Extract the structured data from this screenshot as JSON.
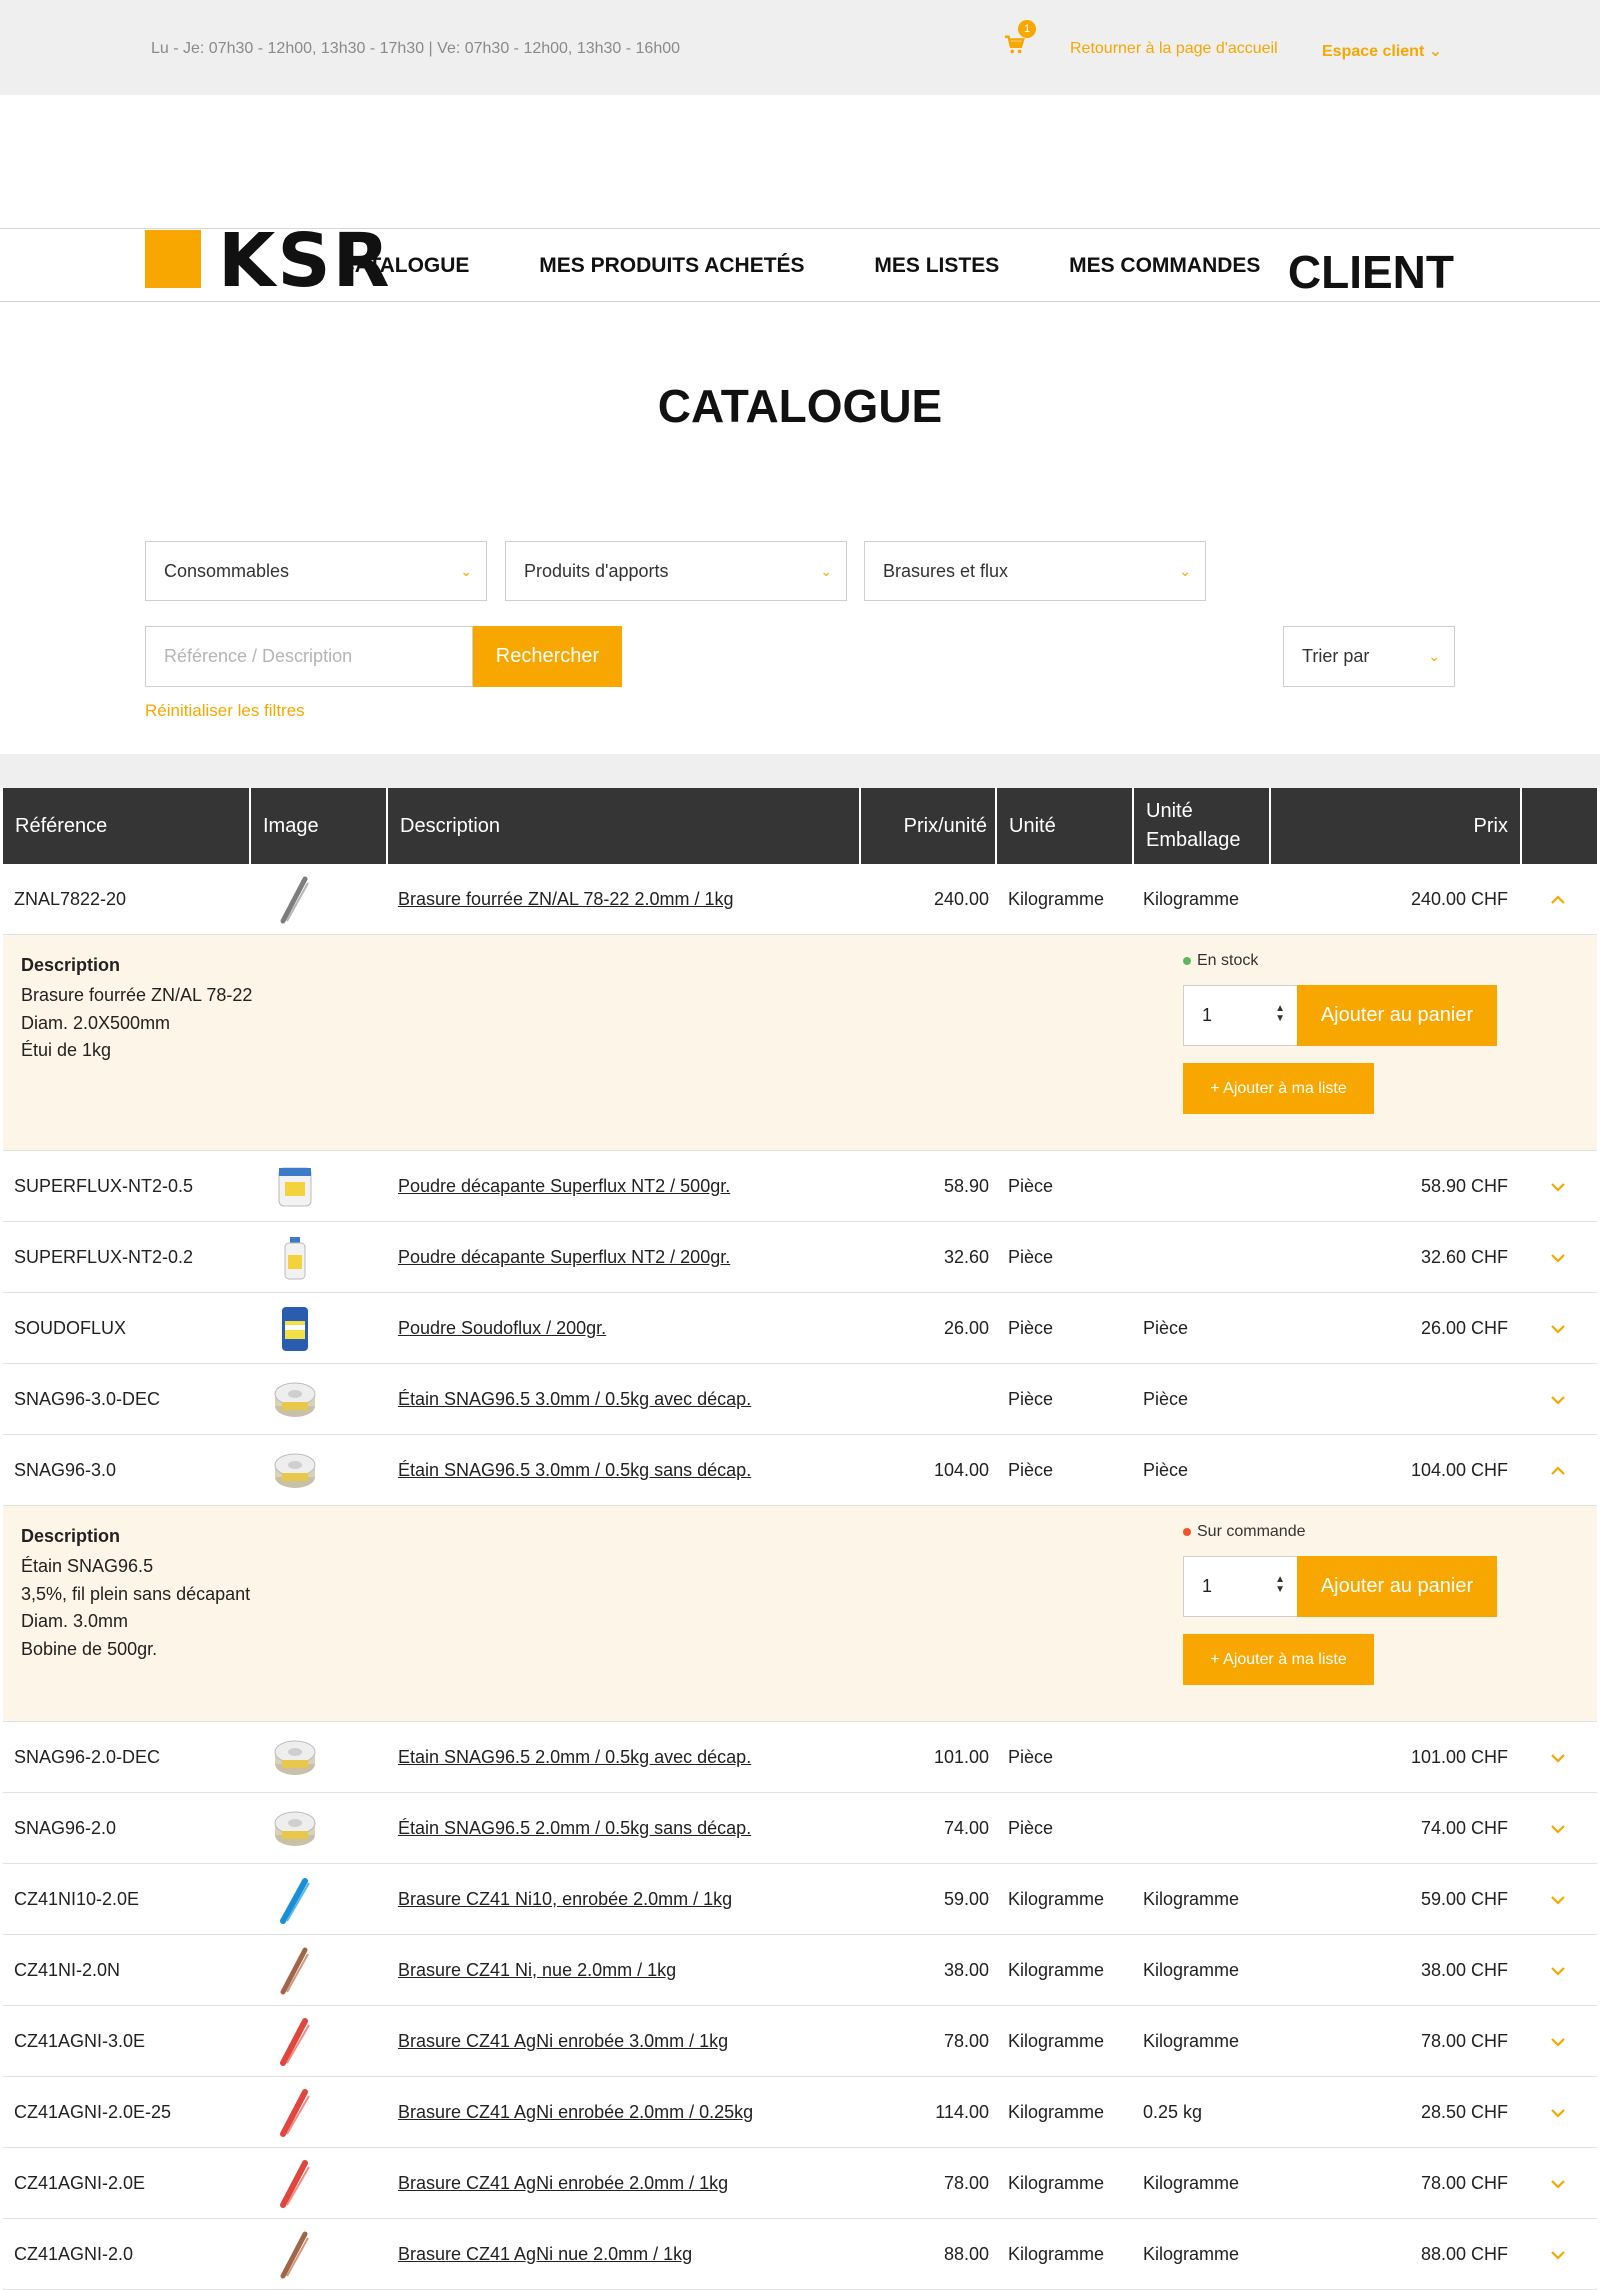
{
  "topbar": {
    "hours": "Lu - Je: 07h30 - 12h00, 13h30 - 17h30 | Ve: 07h30 - 12h00, 13h30 - 16h00",
    "cart_count": "1",
    "home_link": "Retourner à la page d'accueil",
    "espace_client": "Espace client ⌄"
  },
  "header": {
    "logo": "KSR",
    "title": "CLIENT"
  },
  "nav": [
    "CATALOGUE",
    "MES PRODUITS ACHETÉS",
    "MES LISTES",
    "MES COMMANDES"
  ],
  "page_title": "CATALOGUE",
  "filters": {
    "cat1": "Consommables",
    "cat2": "Produits d'apports",
    "cat3": "Brasures et flux",
    "search_placeholder": "Référence / Description",
    "search_button": "Rechercher",
    "sort": "Trier par",
    "reset": "Réinitialiser les filtres"
  },
  "table": {
    "headers": [
      "Référence",
      "Image",
      "Description",
      "Prix/unité",
      "Unité",
      "Unité Emballage",
      "Prix"
    ],
    "rows": [
      {
        "ref": "ZNAL7822-20",
        "img": "rod-grey",
        "desc": "Brasure fourrée ZN/AL 78-22 2.0mm / 1kg",
        "pu": "240.00",
        "unit": "Kilogramme",
        "ue": "Kilogramme",
        "prix": "240.00 CHF",
        "open": true,
        "detail": {
          "head": "Description",
          "lines": [
            "Brasure fourrée ZN/AL 78-22",
            "Diam. 2.0X500mm",
            "Étui de 1kg"
          ],
          "stock": "En stock",
          "stock_color": "#5cb85c",
          "qty": "1",
          "add_cart": "Ajouter au panier",
          "add_list": "+  Ajouter à ma liste"
        }
      },
      {
        "ref": "SUPERFLUX-NT2-0.5",
        "img": "jar-white",
        "desc": "Poudre décapante Superflux NT2 / 500gr.",
        "pu": "58.90",
        "unit": "Pièce",
        "ue": "",
        "prix": "58.90 CHF",
        "open": false
      },
      {
        "ref": "SUPERFLUX-NT2-0.2",
        "img": "bottle-white",
        "desc": "Poudre décapante Superflux NT2 / 200gr.",
        "pu": "32.60",
        "unit": "Pièce",
        "ue": "",
        "prix": "32.60 CHF",
        "open": false
      },
      {
        "ref": "SOUDOFLUX",
        "img": "jar-blue",
        "desc": "Poudre Soudoflux / 200gr.",
        "pu": "26.00",
        "unit": "Pièce",
        "ue": "Pièce",
        "prix": "26.00 CHF",
        "open": false
      },
      {
        "ref": "SNAG96-3.0-DEC",
        "img": "spool",
        "desc": "Étain SNAG96.5 3.0mm / 0.5kg avec décap.",
        "pu": "",
        "unit": "Pièce",
        "ue": "Pièce",
        "prix": "",
        "open": false
      },
      {
        "ref": "SNAG96-3.0",
        "img": "spool",
        "desc": "Étain SNAG96.5 3.0mm / 0.5kg sans décap.",
        "pu": "104.00",
        "unit": "Pièce",
        "ue": "Pièce",
        "prix": "104.00 CHF",
        "open": true,
        "detail": {
          "head": "Description",
          "lines": [
            "Étain SNAG96.5",
            "3,5%, fil plein sans décapant",
            "Diam. 3.0mm",
            "Bobine de 500gr."
          ],
          "stock": "Sur commande",
          "stock_color": "#f0522a",
          "qty": "1",
          "add_cart": "Ajouter au panier",
          "add_list": "+  Ajouter à ma liste"
        }
      },
      {
        "ref": "SNAG96-2.0-DEC",
        "img": "spool",
        "desc": "Etain SNAG96.5 2.0mm / 0.5kg avec décap.",
        "pu": "101.00",
        "unit": "Pièce",
        "ue": "",
        "prix": "101.00 CHF",
        "open": false
      },
      {
        "ref": "SNAG96-2.0",
        "img": "spool",
        "desc": "Étain SNAG96.5 2.0mm / 0.5kg sans décap.",
        "pu": "74.00",
        "unit": "Pièce",
        "ue": "",
        "prix": "74.00 CHF",
        "open": false
      },
      {
        "ref": "CZ41NI10-2.0E",
        "img": "rod-blue",
        "desc": "Brasure CZ41 Ni10, enrobée 2.0mm / 1kg",
        "pu": "59.00",
        "unit": "Kilogramme",
        "ue": "Kilogramme",
        "prix": "59.00 CHF",
        "open": false
      },
      {
        "ref": "CZ41NI-2.0N",
        "img": "rod-copper",
        "desc": "Brasure CZ41 Ni, nue 2.0mm / 1kg",
        "pu": "38.00",
        "unit": "Kilogramme",
        "ue": "Kilogramme",
        "prix": "38.00 CHF",
        "open": false
      },
      {
        "ref": "CZ41AGNI-3.0E",
        "img": "rod-red",
        "desc": "Brasure CZ41 AgNi enrobée 3.0mm / 1kg",
        "pu": "78.00",
        "unit": "Kilogramme",
        "ue": "Kilogramme",
        "prix": "78.00 CHF",
        "open": false
      },
      {
        "ref": "CZ41AGNI-2.0E-25",
        "img": "rod-red",
        "desc": "Brasure CZ41 AgNi enrobée 2.0mm / 0.25kg",
        "pu": "114.00",
        "unit": "Kilogramme",
        "ue": "0.25 kg",
        "prix": "28.50 CHF",
        "open": false
      },
      {
        "ref": "CZ41AGNI-2.0E",
        "img": "rod-red",
        "desc": "Brasure CZ41 AgNi enrobée 2.0mm / 1kg",
        "pu": "78.00",
        "unit": "Kilogramme",
        "ue": "Kilogramme",
        "prix": "78.00 CHF",
        "open": false
      },
      {
        "ref": "CZ41AGNI-2.0",
        "img": "rod-copper",
        "desc": "Brasure CZ41 AgNi nue 2.0mm / 1kg",
        "pu": "88.00",
        "unit": "Kilogramme",
        "ue": "Kilogramme",
        "prix": "88.00 CHF",
        "open": false
      }
    ]
  },
  "colors": {
    "accent": "#f7a700",
    "header_dark": "#353535",
    "detail_bg": "#fdf6e8"
  }
}
